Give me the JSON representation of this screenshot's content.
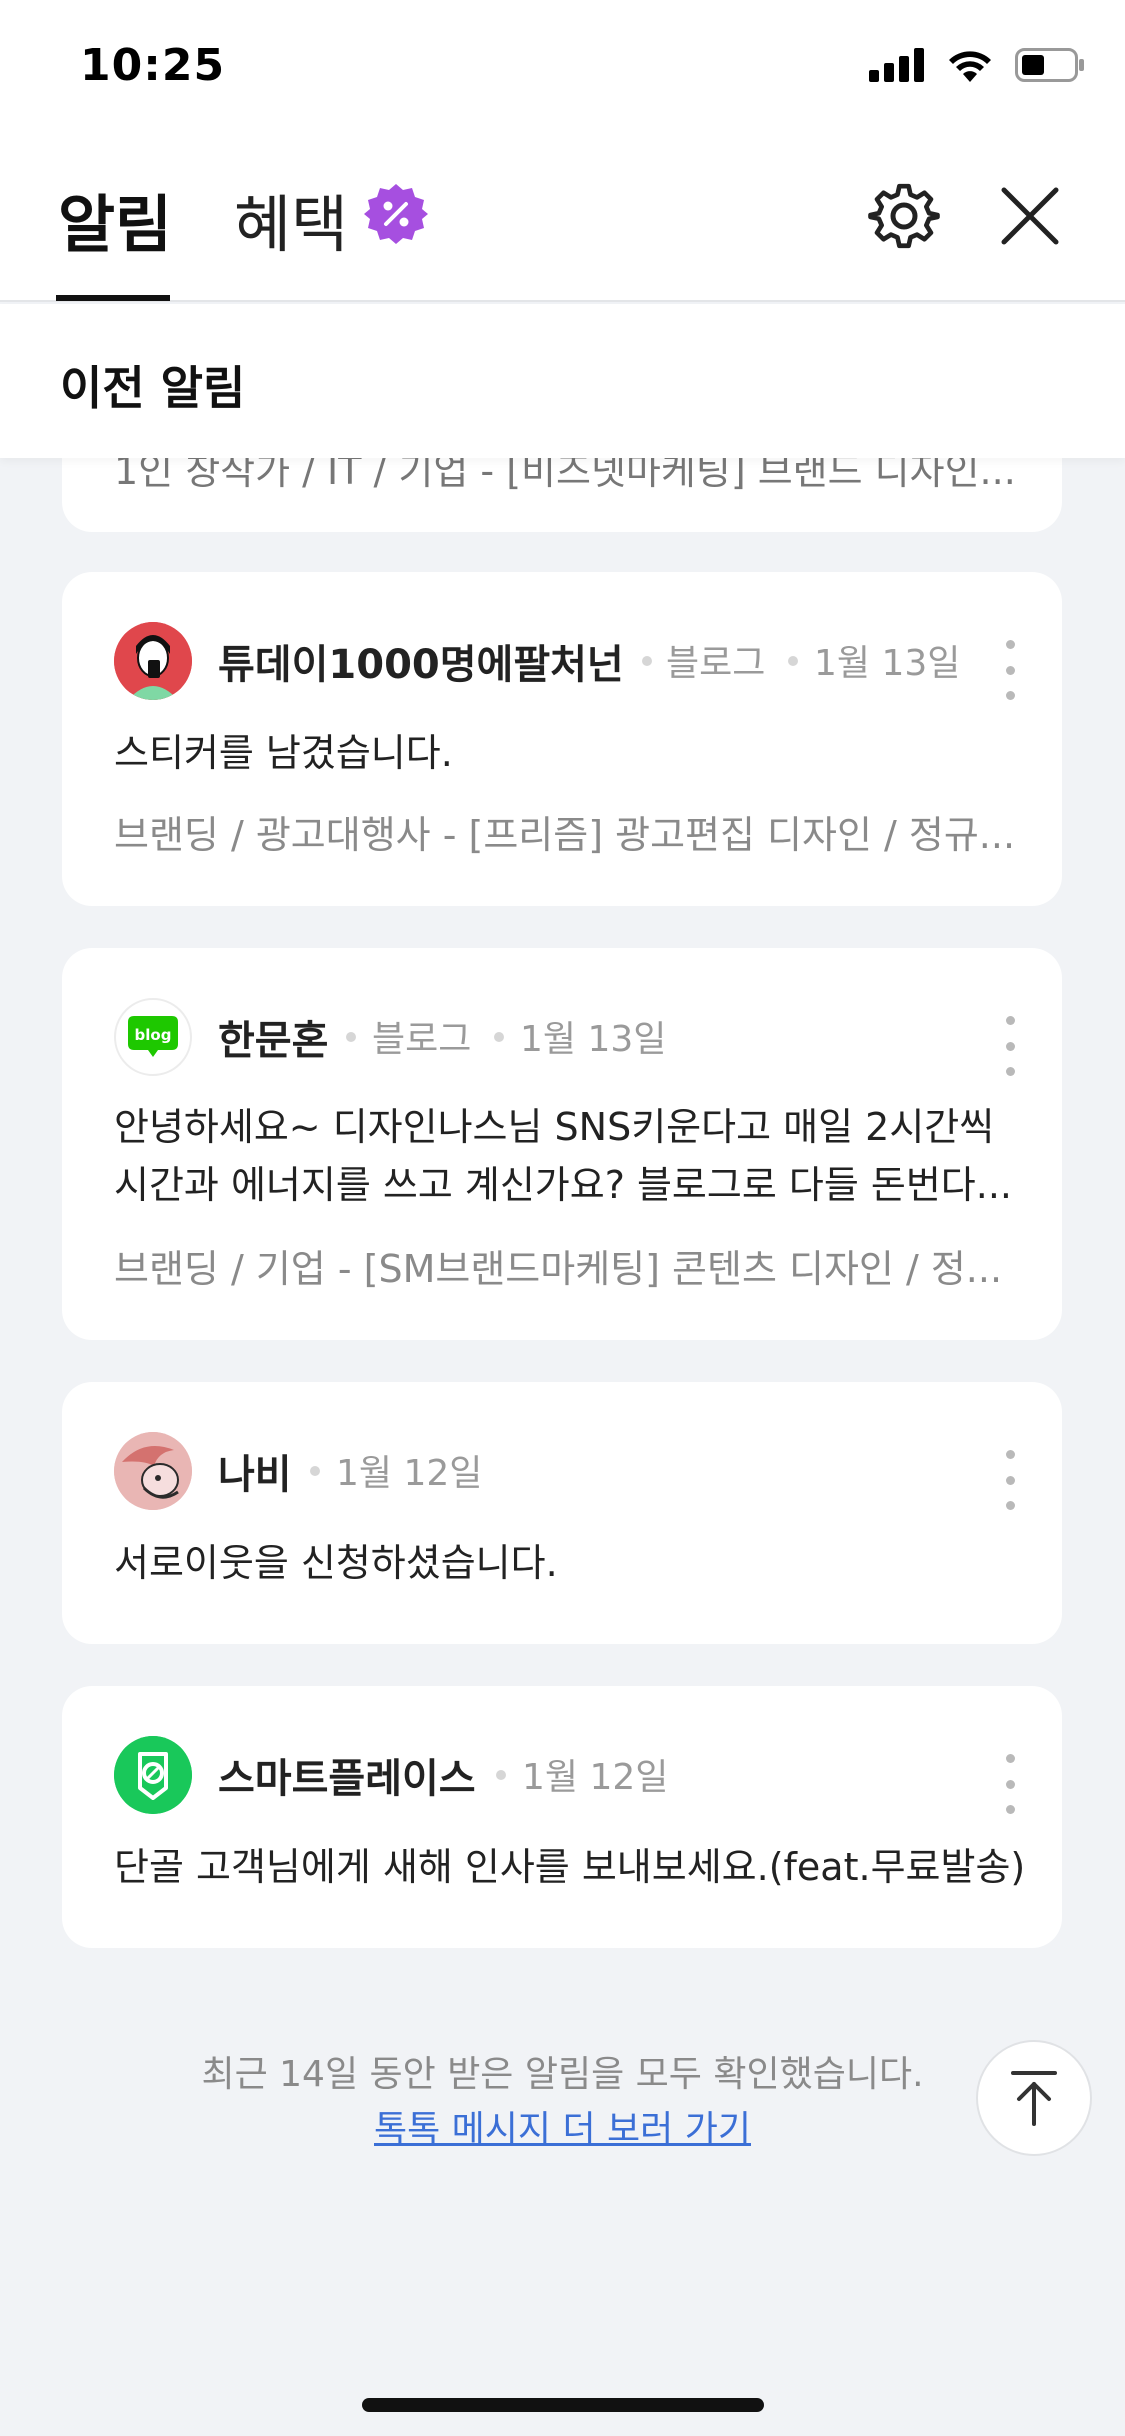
{
  "status_bar": {
    "time": "10:25"
  },
  "tabs": {
    "notifications": "알림",
    "benefits": "혜택"
  },
  "section": {
    "title": "이전 알림"
  },
  "partial_card": {
    "text": "1인 창작가 / IT / 기업 - [비즈넷마케팅] 브랜드 디자인..."
  },
  "notifications": [
    {
      "name": "튜데이1000명에팔처넌",
      "source": "블로그",
      "date": "1월 13일",
      "message": "스티커를 남겼습니다.",
      "sub": "브랜딩 / 광고대행사 - [프리즘] 광고편집 디자인 / 정규..."
    },
    {
      "name": "한문혼",
      "source": "블로그",
      "date": "1월 13일",
      "message_line1": "안녕하세요~ 디자인나스님 SNS키운다고 매일 2시간씩",
      "message_line2": "시간과 에너지를 쓰고 계신가요? 블로그로 다들 돈번다...",
      "sub": "브랜딩 / 기업 - [SM브랜드마케팅] 콘텐츠 디자인 / 정...",
      "avatar_label": "blog"
    },
    {
      "name": "나비",
      "date": "1월 12일",
      "message": "서로이웃을 신청하셨습니다."
    },
    {
      "name": "스마트플레이스",
      "date": "1월 12일",
      "message": "단골 고객님에게 새해 인사를 보내보세요.(feat.무료발송)"
    }
  ],
  "footer": {
    "info": "최근 14일 동안 받은 알림을 모두 확인했습니다.",
    "link": "톡톡 메시지 더 보러 가기"
  },
  "colors": {
    "accent_link": "#3b6fd6",
    "benefit_badge": "#a64fe0",
    "smartplace_green": "#19c85a",
    "blog_green": "#1ec800"
  }
}
